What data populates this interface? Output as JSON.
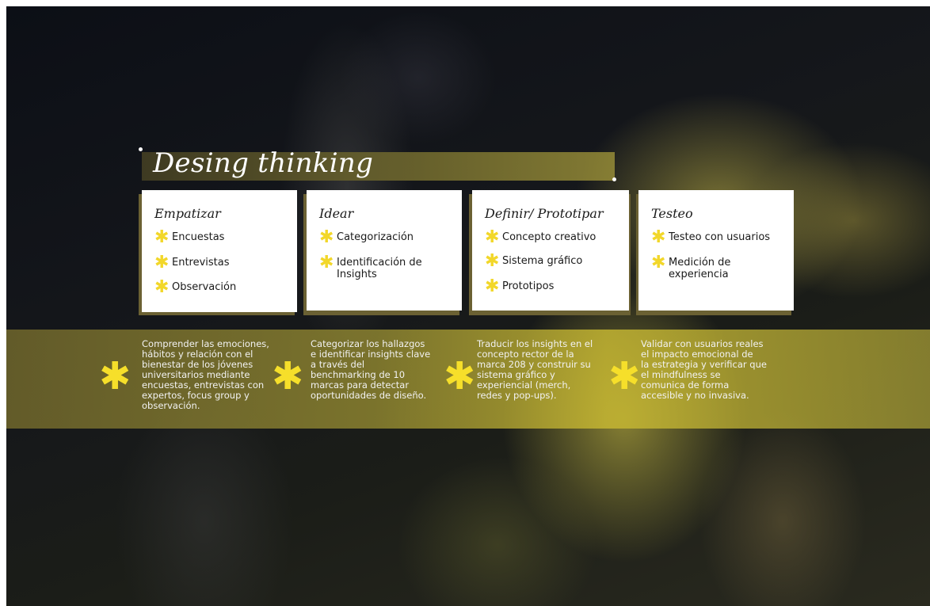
{
  "title": "Desing thinking",
  "stages": [
    {
      "name": "Empatizar",
      "items": [
        "Encuestas",
        "Entrevistas",
        "Observación"
      ],
      "description": "Comprender las emociones,\nhábitos y relación con el\nbienestar de los jóvenes\nuniversitarios mediante\nencuestas, entrevistas con\nexpertos, focus group y\nobservación."
    },
    {
      "name": "Idear",
      "items": [
        "Categorización",
        "Identificación de\nInsights"
      ],
      "description": "Categorizar los hallazgos\ne identificar insights clave\na través del\nbenchmarking de 10\nmarcas para detectar\noportunidades de diseño."
    },
    {
      "name": "Definir/ Prototipar",
      "items": [
        "Concepto creativo",
        "Sistema gráfico",
        "Prototipos"
      ],
      "description": "Traducir los insights en el\nconcepto rector de la\nmarca 208 y construir su\nsistema gráfico y\nexperiencial (merch,\nredes y pop-ups)."
    },
    {
      "name": "Testeo",
      "items": [
        "Testeo con usuarios",
        "Medición de\nexperiencia"
      ],
      "description": "Validar con usuarios reales\nel impacto emocional de\nla estrategia y verificar que\nel mindfulness se\ncomunica de forma\naccesible y no invasiva."
    }
  ],
  "icons": {
    "bullet": "asterisk-icon",
    "band_marker": "asterisk-icon"
  },
  "colors": {
    "accent": "#f2d72a",
    "band": "#a89a3a",
    "card": "#ffffff",
    "card_shadow": "#6b6133"
  }
}
